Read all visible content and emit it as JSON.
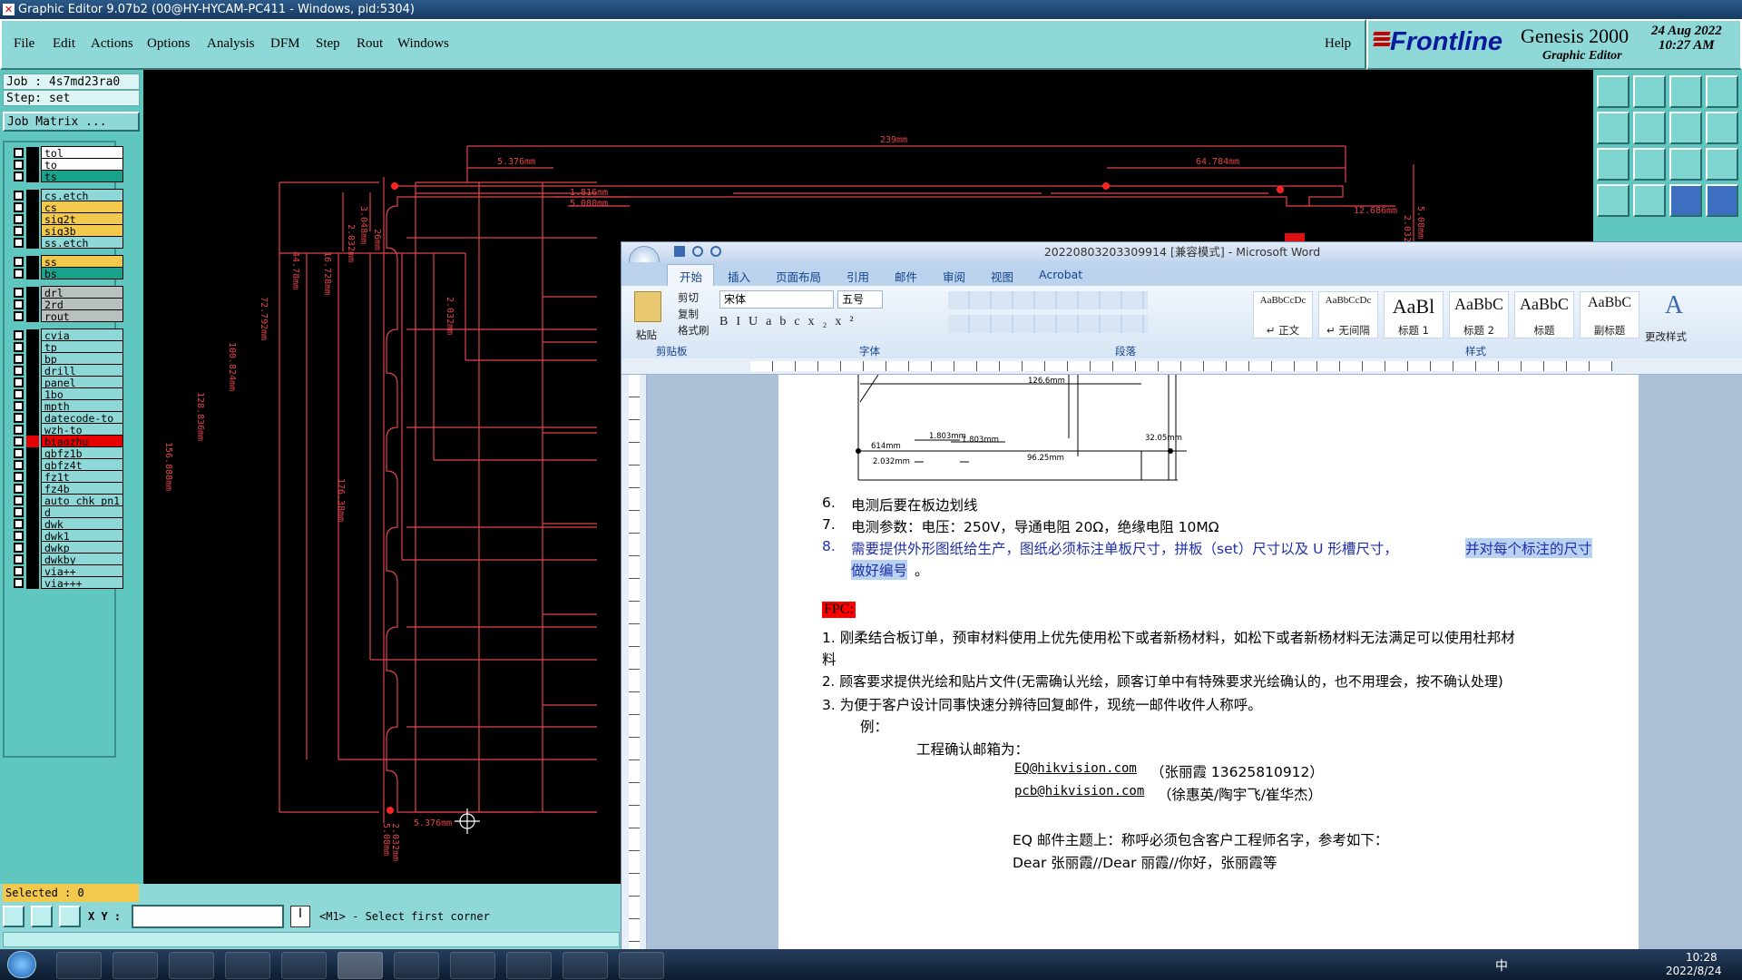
{
  "genesis": {
    "title": "Graphic Editor 9.07b2 (00@HY-HYCAM-PC411 - Windows, pid:5304)",
    "menu": [
      "File",
      "Edit",
      "Actions",
      "Options",
      "Analysis",
      "DFM",
      "Step",
      "Rout",
      "Windows"
    ],
    "help": "Help",
    "brand": "Frontline",
    "product": "Genesis 2000",
    "product_sub": "Graphic Editor",
    "date": "24 Aug 2022",
    "time": "10:27 AM",
    "job": "Job : 4s7md23ra0",
    "step": "Step: set",
    "job_matrix": "Job Matrix ...",
    "layers": [
      {
        "name": "tol",
        "color": "#ffffff"
      },
      {
        "name": "to",
        "color": "#ffffff"
      },
      {
        "name": "ts",
        "color": "#19a38c"
      },
      {
        "name": "cs.etch",
        "color": "#8ed8d8"
      },
      {
        "name": "cs",
        "color": "#f2c94c"
      },
      {
        "name": "sig2t",
        "color": "#f2c94c"
      },
      {
        "name": "sig3b",
        "color": "#f2c94c"
      },
      {
        "name": "ss.etch",
        "color": "#8ed8d8"
      },
      {
        "name": "ss",
        "color": "#f2c94c"
      },
      {
        "name": "bs",
        "color": "#19a38c"
      },
      {
        "name": "drl",
        "color": "#b8c0c0"
      },
      {
        "name": "2rd",
        "color": "#b8c0c0"
      },
      {
        "name": "rout",
        "color": "#b8c0c0"
      },
      {
        "name": "cvia",
        "color": "#8ed8d8"
      },
      {
        "name": "tp",
        "color": "#8ed8d8"
      },
      {
        "name": "bp",
        "color": "#8ed8d8"
      },
      {
        "name": "drill",
        "color": "#8ed8d8"
      },
      {
        "name": "panel",
        "color": "#8ed8d8"
      },
      {
        "name": "1bo",
        "color": "#8ed8d8"
      },
      {
        "name": "mpth",
        "color": "#8ed8d8"
      },
      {
        "name": "datecode-to",
        "color": "#8ed8d8"
      },
      {
        "name": "wzh-to",
        "color": "#8ed8d8"
      },
      {
        "name": "biaozhu",
        "color": "#e60000"
      },
      {
        "name": "gbfz1b",
        "color": "#8ed8d8"
      },
      {
        "name": "gbfz4t",
        "color": "#8ed8d8"
      },
      {
        "name": "fz1t",
        "color": "#8ed8d8"
      },
      {
        "name": "fz4b",
        "color": "#8ed8d8"
      },
      {
        "name": "auto_chk_pn1",
        "color": "#8ed8d8"
      },
      {
        "name": "d",
        "color": "#8ed8d8"
      },
      {
        "name": "dwk",
        "color": "#8ed8d8"
      },
      {
        "name": "dwk1",
        "color": "#8ed8d8"
      },
      {
        "name": "dwkp",
        "color": "#8ed8d8"
      },
      {
        "name": "dwkby",
        "color": "#8ed8d8"
      },
      {
        "name": "via++",
        "color": "#8ed8d8"
      },
      {
        "name": "via+++",
        "color": "#8ed8d8"
      }
    ],
    "selected": "Selected : 0",
    "xy_label": "X Y :",
    "prompt": "<M1> - Select first corner",
    "dims": {
      "top_w": "239mm",
      "top_left": "5.376mm",
      "top_right": "64.784mm",
      "d1": "1.816mm",
      "d2": "5.080mm",
      "d3": "12.686mm",
      "v1": "2.032mm",
      "v2": "3.048mm",
      "v3": "26mm",
      "v4": "16.728mm",
      "v5": "44.78mm",
      "v6": "72.792mm",
      "v7": "100.824mm",
      "v8": "128.836mm",
      "v9": "156.888mm",
      "v10": "176.38mm",
      "v11": "2.032mm",
      "v12": "5.08mm",
      "v13": "2.032mm",
      "bot": "5.376mm",
      "bot_v1": "5.08mm",
      "bot_v2": "2.032mm"
    }
  },
  "word": {
    "title": "20220803203309914 [兼容模式] - Microsoft Word",
    "tabs": [
      "开始",
      "插入",
      "页面布局",
      "引用",
      "邮件",
      "审阅",
      "视图",
      "Acrobat"
    ],
    "clipboard": {
      "paste": "粘贴",
      "cut": "剪切",
      "copy": "复制",
      "format": "格式刷",
      "group": "剪贴板"
    },
    "font": {
      "name": "宋体",
      "size": "五号",
      "group": "字体"
    },
    "para_group": "段落",
    "styles_group": "样式",
    "styles": [
      {
        "preview": "AaBbCcDc",
        "label": "↵ 正文"
      },
      {
        "preview": "AaBbCcDc",
        "label": "↵ 无间隔"
      },
      {
        "preview": "AaBl",
        "label": "标题 1"
      },
      {
        "preview": "AaBbC",
        "label": "标题 2"
      },
      {
        "preview": "AaBbC",
        "label": "标题"
      },
      {
        "preview": "AaBbC",
        "label": "副标题"
      }
    ],
    "change_styles": "更改样式",
    "drawing_dims": {
      "w": "126.6mm",
      "a": "614mm",
      "b": "1.803mm",
      "c": "1.803mm",
      "d": "32.05mm",
      "e": "2.032mm",
      "f": "96.25mm"
    },
    "lines": {
      "l6_num": "6.",
      "l6": "电测后要在板边划线",
      "l7_num": "7.",
      "l7": "电测参数：电压：250V，导通电阻 20Ω，绝缘电阻 10MΩ",
      "l8_num": "8.",
      "l8a": "需要提供外形图纸给生产，图纸必须标注单板尺寸，拼板（set）尺寸以及 U 形槽尺寸，",
      "l8b": "并对每个标注的尺寸",
      "l8c": "做好编号",
      "l8d": "。",
      "fpc": "FPC:",
      "f1": "1. 刚柔结合板订单，预审材料使用上优先使用松下或者新杨材料，如松下或者新杨材料无法满足可以使用杜邦材",
      "f1b": "料",
      "f2": "2. 顾客要求提供光绘和贴片文件(无需确认光绘，顾客订单中有特殊要求光绘确认的，也不用理会，按不确认处理)",
      "f3": "3. 为便于客户设计同事快速分辨待回复邮件，现统一邮件收件人称呼。",
      "ex": "例：",
      "mail_title": "工程确认邮箱为：",
      "mail1": "EQ@hikvision.com",
      "mail1_n": "（张丽霞 13625810912）",
      "mail2": "pcb@hikvision.com",
      "mail2_n": "（徐惠英/陶宇飞/崔华杰）",
      "subj": "EQ 邮件主题上：称呼必须包含客户工程师名字，参考如下：",
      "dear": "Dear  张丽霞//Dear  丽霞//你好，张丽霞等"
    }
  },
  "taskbar": {
    "ime": "中",
    "time": "10:28",
    "date": "2022/8/24"
  },
  "colors": {
    "genesis_panel": "#8ed8d8",
    "canvas": "#000000",
    "outline": "#e0444c",
    "word_blue": "#15428b"
  }
}
